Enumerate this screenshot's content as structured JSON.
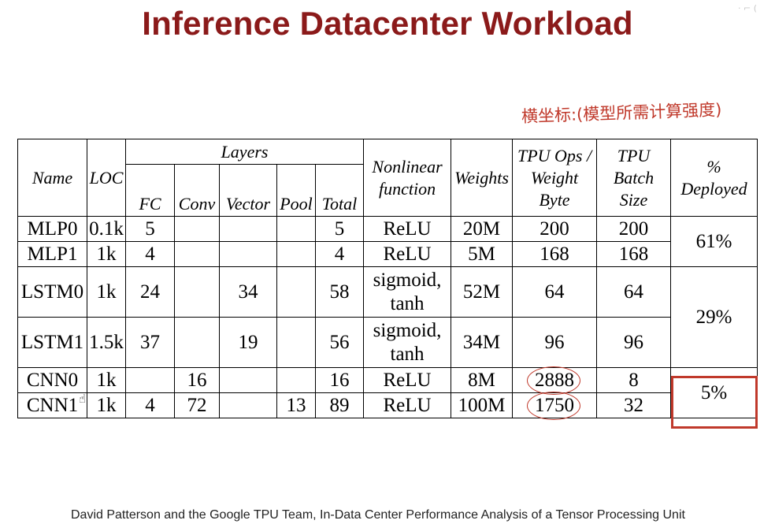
{
  "slide": {
    "title": "Inference Datacenter Workload",
    "annotation": "横坐标:(模型所需计算强度)",
    "citation": "David Patterson and the Google TPU Team, In-Data Center Performance Analysis of a Tensor Processing Unit"
  },
  "table": {
    "headers": {
      "name": "Name",
      "loc": "LOC",
      "layers": "Layers",
      "fc": "FC",
      "conv": "Conv",
      "vector": "Vector",
      "pool": "Pool",
      "total": "Total",
      "nonlinear_line1": "Nonlinear",
      "nonlinear_line2": "function",
      "weights": "Weights",
      "ops_line1": "TPU Ops /",
      "ops_line2": "Weight",
      "ops_line3": "Byte",
      "batch_line1": "TPU",
      "batch_line2": "Batch",
      "batch_line3": "Size",
      "deployed_line1": "%",
      "deployed_line2": "Deployed"
    },
    "rows": [
      {
        "name": "MLP0",
        "loc": "0.1k",
        "fc": "5",
        "conv": "",
        "vector": "",
        "pool": "",
        "total": "5",
        "nonlinear_line1": "ReLU",
        "nonlinear_line2": "",
        "weights": "20M",
        "ops_per_byte": "200",
        "batch_size": "200"
      },
      {
        "name": "MLP1",
        "loc": "1k",
        "fc": "4",
        "conv": "",
        "vector": "",
        "pool": "",
        "total": "4",
        "nonlinear_line1": "ReLU",
        "nonlinear_line2": "",
        "weights": "5M",
        "ops_per_byte": "168",
        "batch_size": "168"
      },
      {
        "name": "LSTM0",
        "loc": "1k",
        "fc": "24",
        "conv": "",
        "vector": "34",
        "pool": "",
        "total": "58",
        "nonlinear_line1": "sigmoid,",
        "nonlinear_line2": "tanh",
        "weights": "52M",
        "ops_per_byte": "64",
        "batch_size": "64"
      },
      {
        "name": "LSTM1",
        "loc": "1.5k",
        "fc": "37",
        "conv": "",
        "vector": "19",
        "pool": "",
        "total": "56",
        "nonlinear_line1": "sigmoid,",
        "nonlinear_line2": "tanh",
        "weights": "34M",
        "ops_per_byte": "96",
        "batch_size": "96"
      },
      {
        "name": "CNN0",
        "loc": "1k",
        "fc": "",
        "conv": "16",
        "vector": "",
        "pool": "",
        "total": "16",
        "nonlinear_line1": "ReLU",
        "nonlinear_line2": "",
        "weights": "8M",
        "ops_per_byte": "2888",
        "batch_size": "8"
      },
      {
        "name": "CNN1",
        "loc": "1k",
        "fc": "4",
        "conv": "72",
        "vector": "",
        "pool": "13",
        "total": "89",
        "nonlinear_line1": "ReLU",
        "nonlinear_line2": "",
        "weights": "100M",
        "ops_per_byte": "1750",
        "batch_size": "32"
      }
    ],
    "deployed": {
      "mlp": "61%",
      "lstm": "29%",
      "cnn": "5%"
    }
  },
  "colors": {
    "title": "#8b1a1a",
    "annotation_ink": "#c0392b"
  }
}
